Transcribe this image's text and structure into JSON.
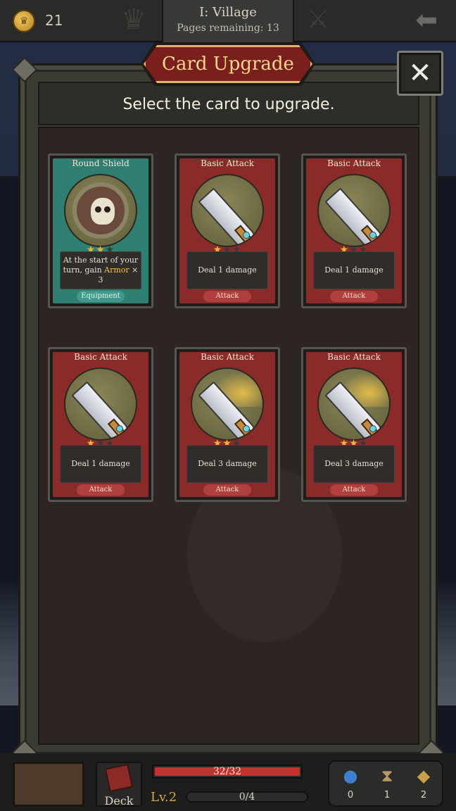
{
  "topbar": {
    "coins": "21",
    "stage_title": "I: Village",
    "pages_remaining": "Pages remaining: 13"
  },
  "dialog": {
    "title": "Card Upgrade",
    "subtitle": "Select the card to upgrade.",
    "close_label": "✕"
  },
  "cards": [
    {
      "name": "Round Shield",
      "style": "teal",
      "art": "shield",
      "stars": 2,
      "max_stars": 3,
      "desc_pre": "At the start of your turn, gain",
      "desc_hl": "Armor",
      "desc_post": "× 3",
      "tag": "Equipment"
    },
    {
      "name": "Basic Attack",
      "style": "red",
      "art": "sword",
      "stars": 1,
      "max_stars": 3,
      "desc_pre": "Deal 1 damage",
      "desc_hl": "",
      "desc_post": "",
      "tag": "Attack"
    },
    {
      "name": "Basic Attack",
      "style": "red",
      "art": "sword",
      "stars": 1,
      "max_stars": 3,
      "desc_pre": "Deal 1 damage",
      "desc_hl": "",
      "desc_post": "",
      "tag": "Attack"
    },
    {
      "name": "Basic Attack",
      "style": "red",
      "art": "sword",
      "stars": 1,
      "max_stars": 3,
      "desc_pre": "Deal 1 damage",
      "desc_hl": "",
      "desc_post": "",
      "tag": "Attack"
    },
    {
      "name": "Basic Attack",
      "style": "red",
      "art": "sword-glow",
      "stars": 2,
      "max_stars": 3,
      "desc_pre": "Deal 3 damage",
      "desc_hl": "",
      "desc_post": "",
      "tag": "Attack"
    },
    {
      "name": "Basic Attack",
      "style": "red",
      "art": "sword-glow",
      "stars": 2,
      "max_stars": 3,
      "desc_pre": "Deal 3 damage",
      "desc_hl": "",
      "desc_post": "",
      "tag": "Attack"
    }
  ],
  "bottombar": {
    "deck_label": "Deck",
    "hp_text": "32/32",
    "hp_fraction": 1.0,
    "level_label": "Lv.2",
    "xp_text": "0/4",
    "inventory": [
      {
        "icon": "potion-icon",
        "count": "0"
      },
      {
        "icon": "hourglass-icon",
        "count": "1"
      },
      {
        "icon": "map-icon",
        "count": "2"
      }
    ]
  }
}
